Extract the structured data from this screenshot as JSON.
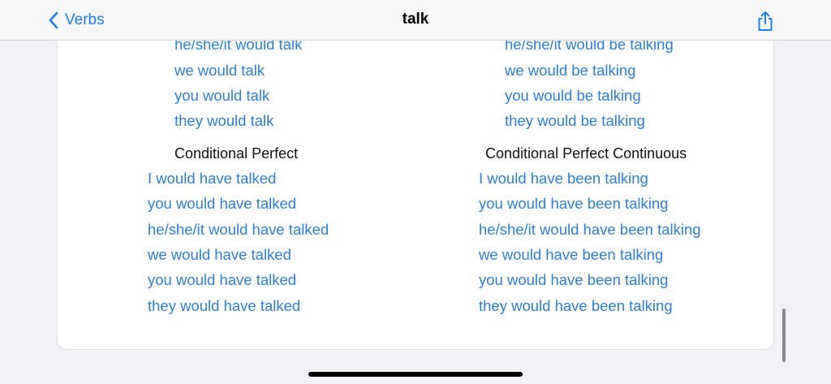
{
  "nav": {
    "back_label": "Verbs",
    "title": "talk"
  },
  "left": {
    "top_lines": [
      "he/she/it would talk",
      "we would talk",
      "you would talk",
      "they would talk"
    ],
    "heading": "Conditional Perfect",
    "lines": [
      "I would have talked",
      "you would have talked",
      "he/she/it would have talked",
      "we would have talked",
      "you would have talked",
      "they would have talked"
    ]
  },
  "right": {
    "top_lines": [
      "he/she/it would be talking",
      "we would be talking",
      "you would be talking",
      "they would be talking"
    ],
    "heading": "Conditional Perfect Continuous",
    "lines": [
      "I would have been talking",
      "you would have been talking",
      "he/she/it would have been talking",
      "we would have been talking",
      "you would have been talking",
      "they would have been talking"
    ]
  },
  "colors": {
    "accent": "#1a7ef5",
    "form_text": "#2a80d8"
  }
}
